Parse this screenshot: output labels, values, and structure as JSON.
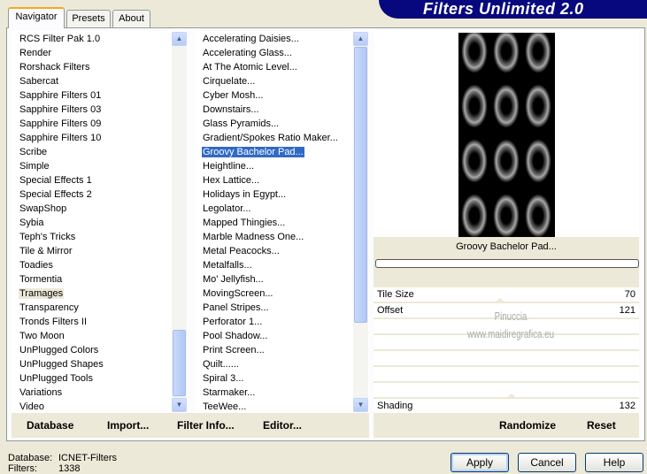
{
  "app_title": "Filters Unlimited 2.0",
  "tabs": [
    {
      "label": "Navigator"
    },
    {
      "label": "Presets"
    },
    {
      "label": "About"
    }
  ],
  "categories": [
    "RCS Filter Pak 1.0",
    "Render",
    "Rorshack Filters",
    "Sabercat",
    "Sapphire Filters 01",
    "Sapphire Filters 03",
    "Sapphire Filters 09",
    "Sapphire Filters 10",
    "Scribe",
    "Simple",
    "Special Effects 1",
    "Special Effects 2",
    "SwapShop",
    "Sybia",
    "Teph's Tricks",
    "Tile & Mirror",
    "Toadies",
    "Tormentia",
    "Tramages",
    "Transparency",
    "Tronds Filters II",
    "Two Moon",
    "UnPlugged Colors",
    "UnPlugged Shapes",
    "UnPlugged Tools",
    "Variations",
    "Video"
  ],
  "selected_category": "Tramages",
  "filters": [
    "Accelerating Daisies...",
    "Accelerating Glass...",
    "At The Atomic Level...",
    "Cirquelate...",
    "Cyber Mosh...",
    "Downstairs...",
    "Glass Pyramids...",
    "Gradient/Spokes Ratio Maker...",
    "Groovy Bachelor Pad...",
    "Heightline...",
    "Hex Lattice...",
    "Holidays in Egypt...",
    "Legolator...",
    "Mapped Thingies...",
    "Marble Madness One...",
    "Metal Peacocks...",
    "Metalfalls...",
    "Mo' Jellyfish...",
    "MovingScreen...",
    "Panel Stripes...",
    "Perforator 1...",
    "Pool Shadow...",
    "Print Screen...",
    "Quilt......",
    "Spiral 3...",
    "Starmaker...",
    "TeeWee..."
  ],
  "selected_filter": "Groovy Bachelor Pad...",
  "bottom_buttons": {
    "database": "Database",
    "import": "Import...",
    "filter_info": "Filter Info...",
    "editor": "Editor..."
  },
  "preview": {
    "filter_name": "Groovy Bachelor Pad...",
    "progress": 0
  },
  "params": [
    {
      "label": "Tile Size",
      "value": "70"
    },
    {
      "label": "Offset",
      "value": "121"
    },
    {
      "label": "Shading",
      "value": "132"
    }
  ],
  "param_range": [
    0,
    255
  ],
  "watermark": {
    "line1": "Pinuccia",
    "line2": "www.maidiregrafica.eu"
  },
  "randomize": "Randomize",
  "reset": "Reset",
  "status": {
    "database_label": "Database:",
    "database_value": "ICNET-Filters",
    "filters_label": "Filters:",
    "filters_value": "1338"
  },
  "dialog": {
    "apply": "Apply",
    "cancel": "Cancel",
    "help": "Help"
  }
}
